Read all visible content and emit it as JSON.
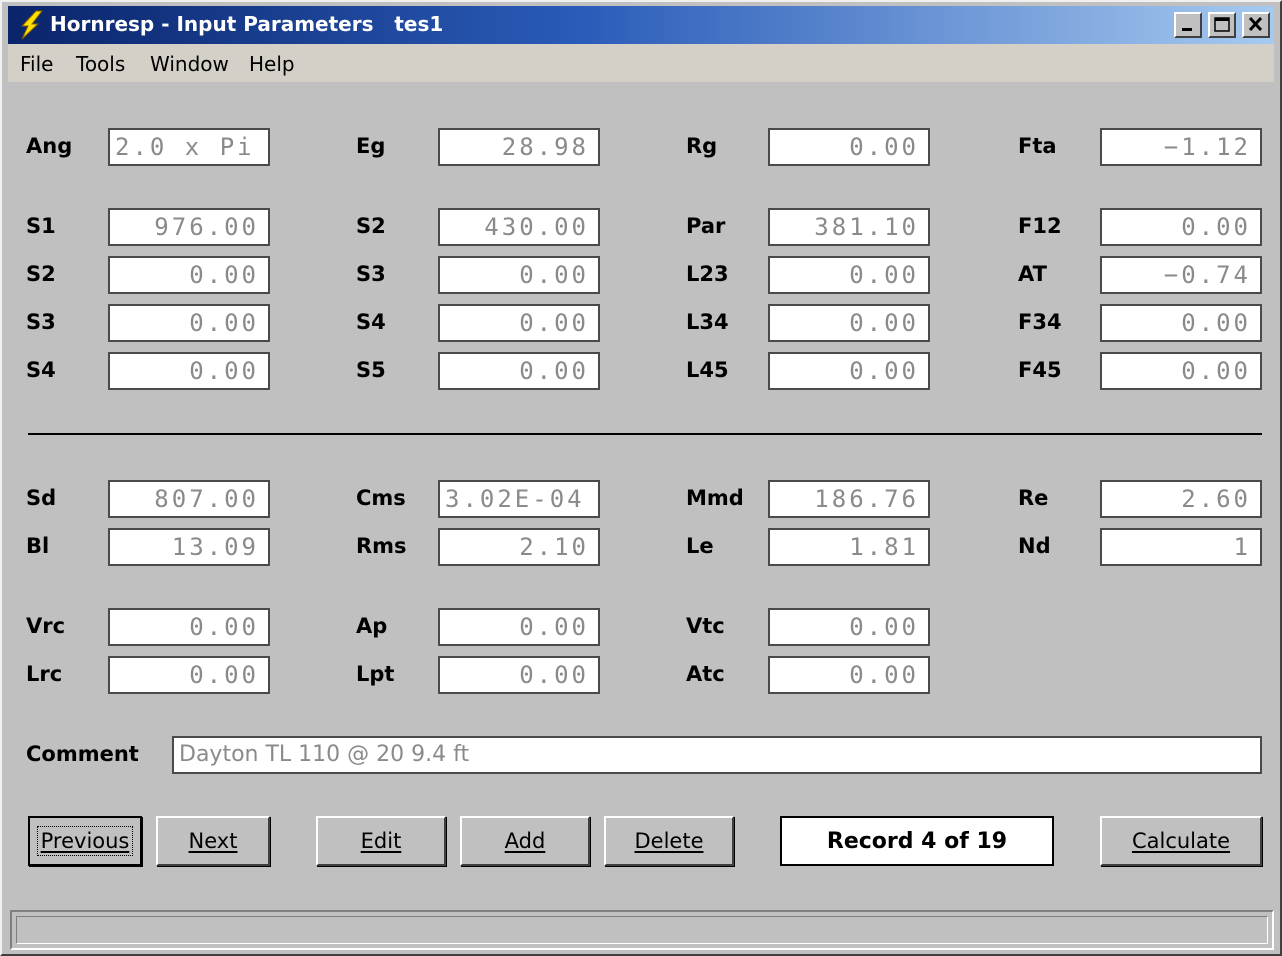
{
  "window": {
    "title": "Hornresp - Input Parameters   tes1",
    "controls": [
      "minimize-icon",
      "maximize-icon",
      "close-icon"
    ]
  },
  "menu": {
    "items": [
      {
        "label": "File"
      },
      {
        "label": "Tools"
      },
      {
        "label": "Window"
      },
      {
        "label": "Help"
      }
    ]
  },
  "params": {
    "Ang": "2.0 x Pi",
    "Eg": "28.98",
    "Rg": "0.00",
    "Fta": "−1.12",
    "S1": "976.00",
    "S2a": "430.00",
    "Par": "381.10",
    "F12": "0.00",
    "S2b": "0.00",
    "S3a": "0.00",
    "L23": "0.00",
    "AT": "−0.74",
    "S3b": "0.00",
    "S4a": "0.00",
    "L34": "0.00",
    "F34": "0.00",
    "S4b": "0.00",
    "S5": "0.00",
    "L45": "0.00",
    "F45": "0.00",
    "Sd": "807.00",
    "Cms": "3.02E-04",
    "Mmd": "186.76",
    "Re": "2.60",
    "Bl": "13.09",
    "Rms": "2.10",
    "Le": "1.81",
    "Nd": "1",
    "Vrc": "0.00",
    "Ap": "0.00",
    "Vtc": "0.00",
    "Lrc": "0.00",
    "Lpt": "0.00",
    "Atc": "0.00"
  },
  "labels": {
    "Ang": "Ang",
    "Eg": "Eg",
    "Rg": "Rg",
    "Fta": "Fta",
    "S1": "S1",
    "S2a": "S2",
    "Par": "Par",
    "F12": "F12",
    "S2b": "S2",
    "S3a": "S3",
    "L23": "L23",
    "AT": "AT",
    "S3b": "S3",
    "S4a": "S4",
    "L34": "L34",
    "F34": "F34",
    "S4b": "S4",
    "S5": "S5",
    "L45": "L45",
    "F45": "F45",
    "Sd": "Sd",
    "Cms": "Cms",
    "Mmd": "Mmd",
    "Re": "Re",
    "Bl": "Bl",
    "Rms": "Rms",
    "Le": "Le",
    "Nd": "Nd",
    "Vrc": "Vrc",
    "Ap": "Ap",
    "Vtc": "Vtc",
    "Lrc": "Lrc",
    "Lpt": "Lpt",
    "Atc": "Atc"
  },
  "comment": {
    "label": "Comment",
    "value": "Dayton TL 110 @ 20 9.4 ft"
  },
  "buttons": {
    "previous": "Previous",
    "next": "Next",
    "edit": "Edit",
    "add": "Add",
    "delete": "Delete",
    "calculate": "Calculate"
  },
  "record": "Record 4 of 19",
  "colors": {
    "title_bar_start": "#0a246a",
    "title_bar_end": "#a6caf0",
    "face": "#c0c0c0",
    "field_text": "#8a8a8a"
  }
}
